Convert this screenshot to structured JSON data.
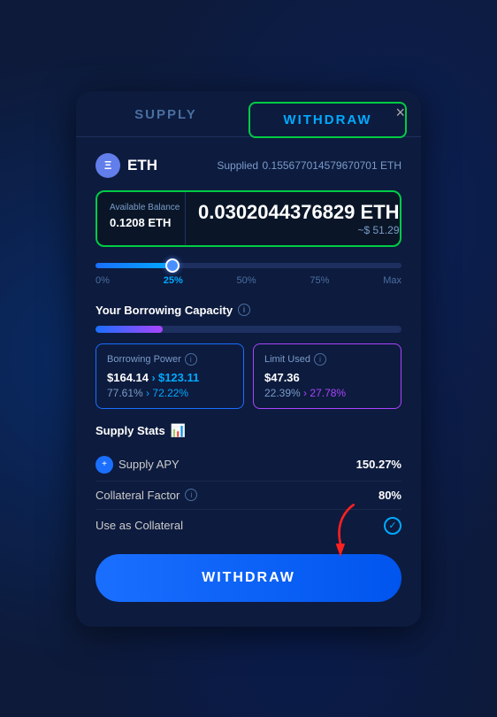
{
  "modal": {
    "close_label": "×",
    "tabs": {
      "supply_label": "SUPPLY",
      "withdraw_label": "WITHDRAW"
    },
    "asset": {
      "symbol": "ETH",
      "icon_text": "Ξ",
      "supplied_label": "Supplied",
      "supplied_value": "0.155677014579670701 ETH"
    },
    "balance_box": {
      "avail_label": "Available Balance",
      "avail_value": "0.1208 ETH",
      "amount_main": "0.0302044376829 ETH",
      "amount_usd": "~$ 51.29"
    },
    "slider": {
      "pct_0": "0%",
      "pct_25": "25%",
      "pct_50": "50%",
      "pct_75": "75%",
      "pct_max": "Max",
      "active_pct": "25%"
    },
    "borrowing_capacity": {
      "title": "Your Borrowing Capacity",
      "borrow_power_title": "Borrowing Power",
      "borrow_power_old": "$164.14",
      "borrow_power_new": "$123.11",
      "borrow_pct_old": "77.61%",
      "borrow_pct_new": "72.22%",
      "limit_used_title": "Limit Used",
      "limit_used_old": "$47.36",
      "limit_pct_old": "22.39%",
      "limit_pct_new": "27.78%"
    },
    "supply_stats": {
      "title": "Supply Stats",
      "supply_apy_label": "Supply APY",
      "supply_apy_value": "150.27%",
      "collateral_factor_label": "Collateral Factor",
      "collateral_factor_value": "80%",
      "use_as_collateral_label": "Use as Collateral"
    },
    "withdraw_button_label": "WITHDRAW"
  }
}
